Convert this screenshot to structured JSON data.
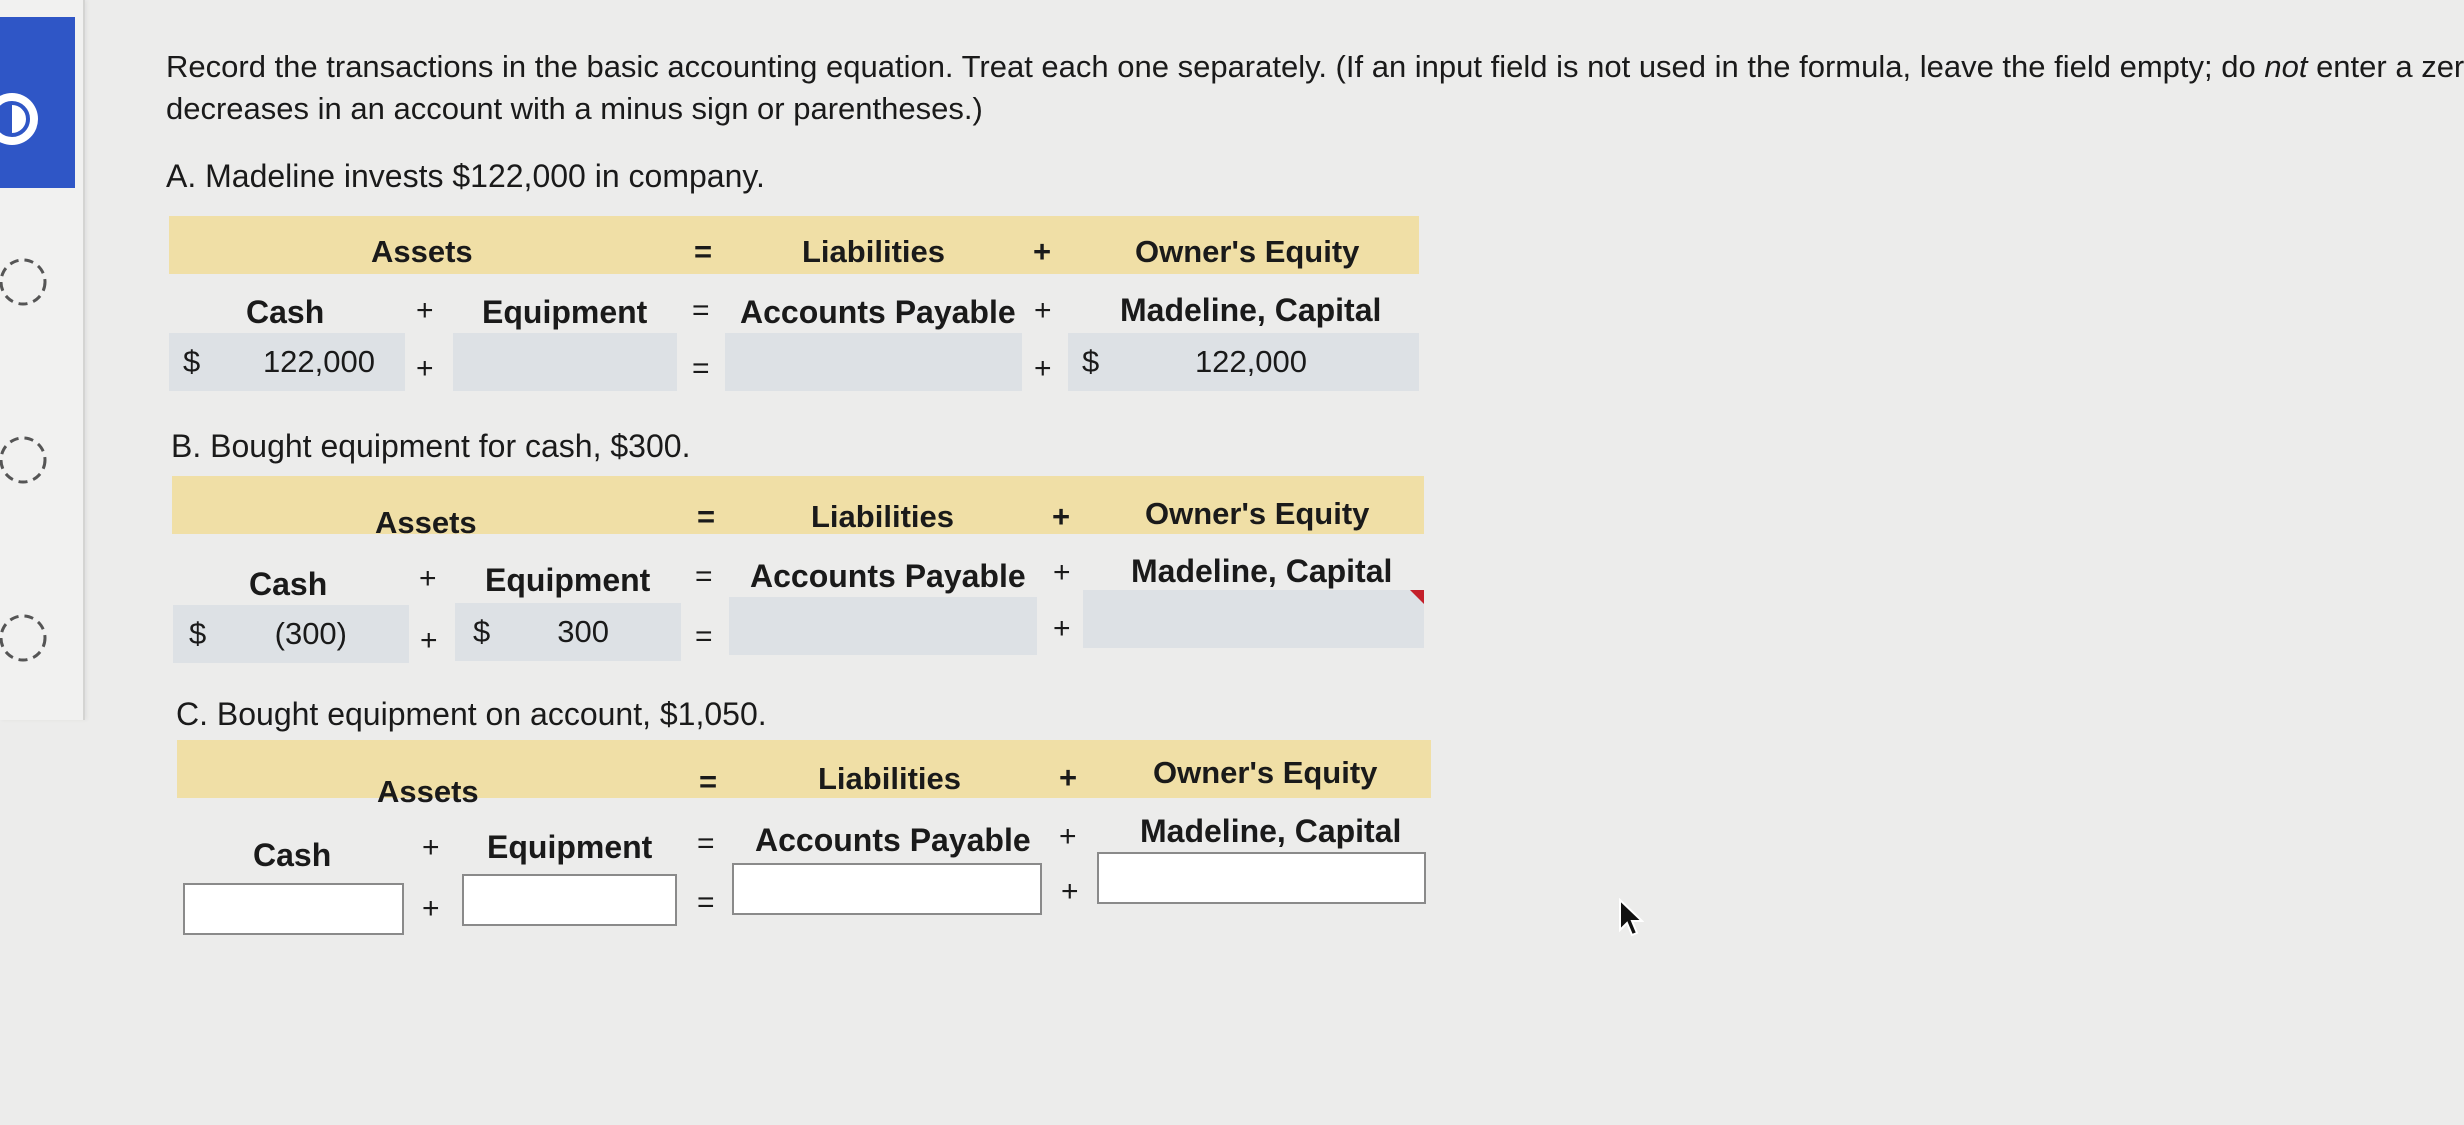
{
  "rail": {
    "active_icon": "half-circle-icon",
    "question_icons": [
      "dashed-circle-icon",
      "dashed-circle-icon",
      "dashed-circle-icon"
    ],
    "accent_color": "#2f56c6"
  },
  "instructions": {
    "line1_a": "Record the transactions in the basic accounting equation. Treat each one separately. (If an input field is not used in the formula, leave the field empty; do ",
    "line1_em": "not",
    "line1_b": " enter a zero. E",
    "line2": "decreases in an account with a minus sign or parentheses.)"
  },
  "header": {
    "assets": "Assets",
    "equals": "=",
    "liabilities": "Liabilities",
    "plus": "+",
    "owners_equity": "Owner's Equity",
    "band_color": "#f0dfa6"
  },
  "columns": {
    "cash": "Cash",
    "plus": "+",
    "equipment": "Equipment",
    "equals": "=",
    "accounts_payable": "Accounts Payable",
    "capital": "Madeline, Capital"
  },
  "questions": [
    {
      "label": "A. Madeline invests $122,000 in company.",
      "cash": {
        "dollar": "$",
        "value": "122,000"
      },
      "equipment": {
        "dollar": "",
        "value": ""
      },
      "accounts_payable": {
        "dollar": "",
        "value": ""
      },
      "capital": {
        "dollar": "$",
        "value": "122,000"
      }
    },
    {
      "label": "B. Bought equipment for cash, $300.",
      "cash": {
        "dollar": "$",
        "value": "(300)"
      },
      "equipment": {
        "dollar": "$",
        "value": "300"
      },
      "accounts_payable": {
        "dollar": "",
        "value": ""
      },
      "capital": {
        "dollar": "",
        "value": ""
      }
    },
    {
      "label": "C. Bought equipment on account, $1,050.",
      "cash": {
        "dollar": "",
        "value": ""
      },
      "equipment": {
        "dollar": "",
        "value": ""
      },
      "accounts_payable": {
        "dollar": "",
        "value": ""
      },
      "capital": {
        "dollar": "",
        "value": ""
      }
    }
  ]
}
